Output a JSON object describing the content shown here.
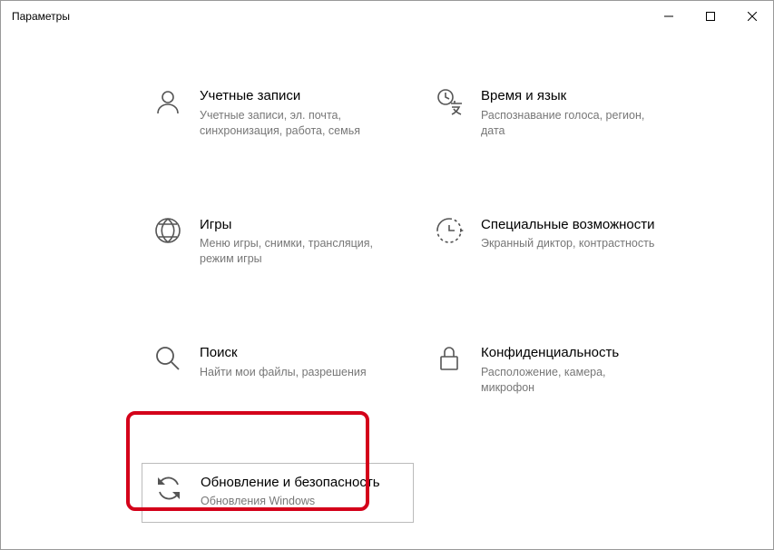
{
  "window": {
    "title": "Параметры"
  },
  "tiles": {
    "accounts": {
      "title": "Учетные записи",
      "desc": "Учетные записи, эл. почта, синхронизация, работа, семья"
    },
    "time": {
      "title": "Время и язык",
      "desc": "Распознавание голоса, регион, дата"
    },
    "gaming": {
      "title": "Игры",
      "desc": "Меню игры, снимки, трансляция, режим игры"
    },
    "access": {
      "title": "Специальные возможности",
      "desc": "Экранный диктор, контрастность"
    },
    "search": {
      "title": "Поиск",
      "desc": "Найти мои файлы, разрешения"
    },
    "privacy": {
      "title": "Конфиденциальность",
      "desc": "Расположение, камера, микрофон"
    },
    "update": {
      "title": "Обновление и безопасность",
      "desc": "Обновления Windows"
    }
  }
}
